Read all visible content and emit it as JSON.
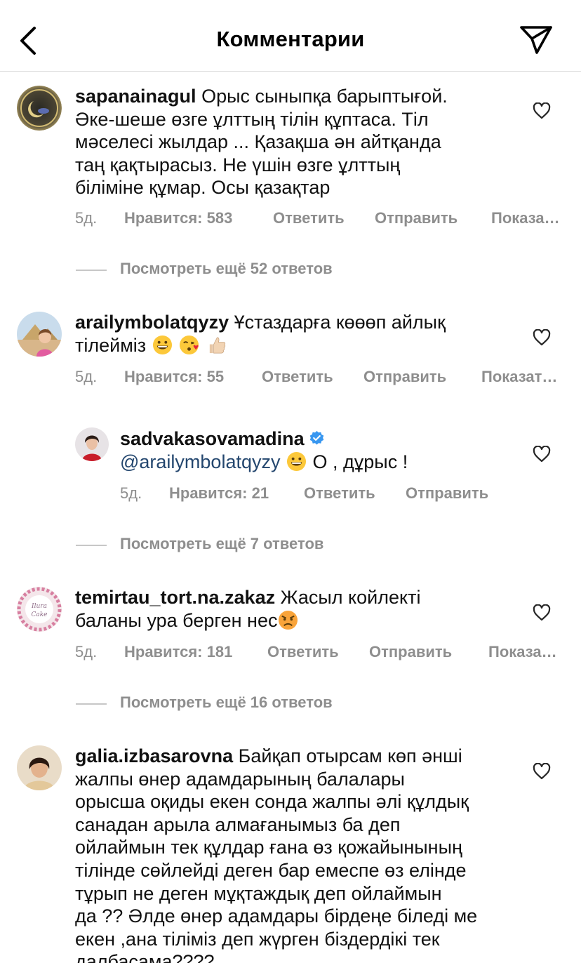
{
  "header": {
    "title": "Комментарии",
    "back_icon": "chevron-left-icon",
    "send_icon": "paper-plane-icon"
  },
  "comments": [
    {
      "username": "sapanainagul",
      "text": "Орыс сыныпқа барыптығой. Әке-шеше өзге ұлттың тілін құптаса. Тіл мәселесі жылдар ... Қазақша ән айтқанда таң қақтырасыз. Не үшін өзге ұлттың біліміне құмар. Осы қазақтар",
      "lines": [
        "Орыс сыныпқа барыптығой.",
        "Әке-шеше өзге ұлттың тілін құптаса. Тіл",
        "мәселесі жылдар ... Қазақша ән айтқанда",
        "таң қақтырасыз. Не үшін өзге ұлттың",
        "біліміне құмар. Осы қазақтар"
      ],
      "time": "5д.",
      "likes": "Нравится: 583",
      "reply": "Ответить",
      "send": "Отправить",
      "show": "Показа…",
      "more_replies": "Посмотреть ещё 52 ответов"
    },
    {
      "username": "arailymbolatqyzy",
      "lines": [
        "Ұстаздарға көөөп айлық",
        "тілейміз"
      ],
      "emojis": [
        "grinning-face-emoji",
        "face-blowing-kiss-emoji",
        "thumbs-up-emoji"
      ],
      "time": "5д.",
      "likes": "Нравится: 55",
      "reply": "Ответить",
      "send": "Отправить",
      "show": "Показат…"
    },
    {
      "username": "sadvakasovamadina",
      "verified_icon": "verified-badge-icon",
      "mention": "@arailymbolatqyzy",
      "text": "О , дұрыс !",
      "emojis": [
        "grinning-face-emoji"
      ],
      "time": "5д.",
      "likes": "Нравится: 21",
      "reply": "Ответить",
      "send": "Отправить",
      "more_replies": "Посмотреть ещё 7 ответов"
    },
    {
      "username": "temirtau_tort.na.zakaz",
      "lines": [
        "Жасыл койлекті",
        "баланы ура берген нес"
      ],
      "emojis": [
        "angry-face-emoji"
      ],
      "time": "5д.",
      "likes": "Нравится: 181",
      "reply": "Ответить",
      "send": "Отправить",
      "show": "Показа…",
      "more_replies": "Посмотреть ещё 16 ответов"
    },
    {
      "username": "galia.izbasarovna",
      "lines": [
        "Байқап отырсам көп әнші",
        "жалпы өнер адамдарының балалары",
        "орысша оқиды екен сонда жалпы әлі құлдық",
        "санадан арыла алмағанымыз ба деп",
        "ойлаймын тек құлдар ғана өз қожайынының",
        "тілінде сөйлейді деген бар емеспе өз елінде",
        "тұрып не деген мұқтаждық деп ойлаймын",
        "да ?? Әлде өнер адамдары бірдеңе біледі ме",
        "екен ,ана тіліміз деп жүрген біздердікі тек",
        "далбасама????"
      ]
    }
  ],
  "colors": {
    "secondary_text": "#8e8e8e",
    "mention": "#23466e",
    "verified": "#3897f0",
    "divider": "#dbdbdb"
  },
  "icons": {
    "heart": "heart-outline-icon"
  }
}
